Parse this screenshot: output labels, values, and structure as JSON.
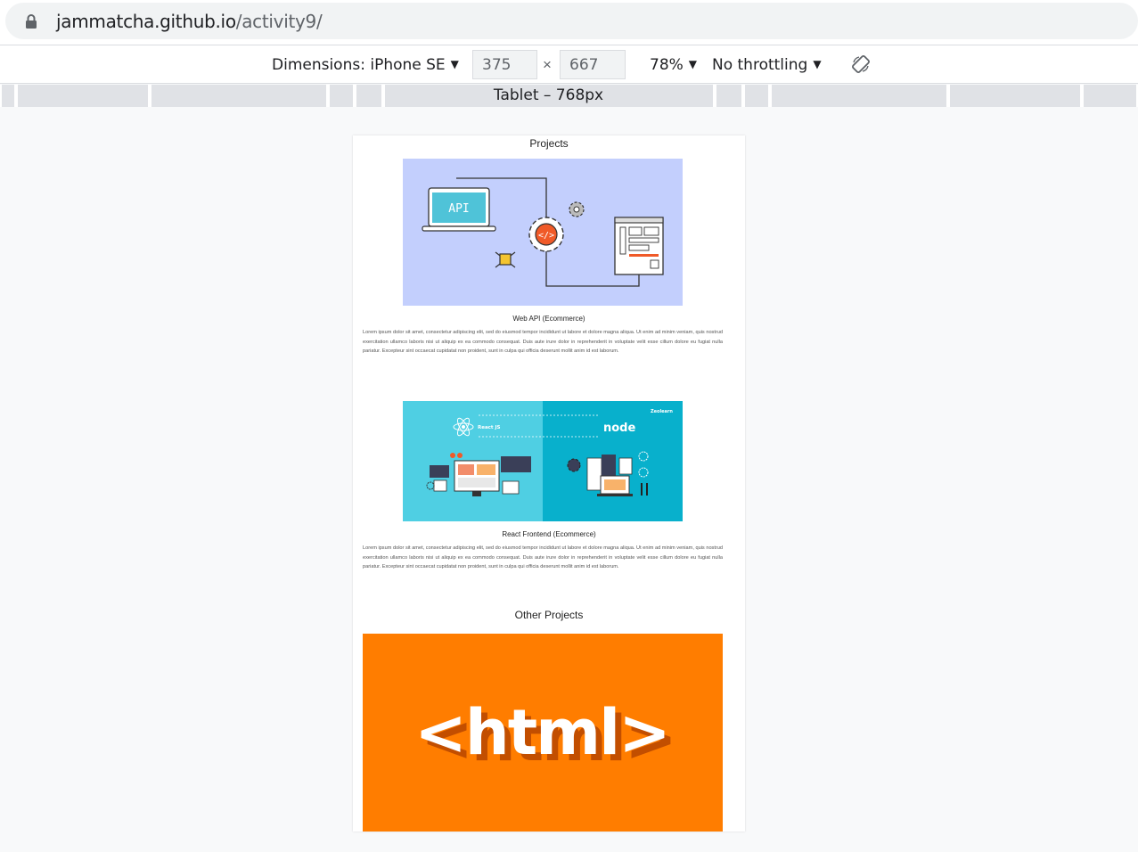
{
  "browser": {
    "url_host": "jammatcha.github.io",
    "url_path": "/activity9/"
  },
  "devtools": {
    "dimensions_label": "Dimensions: iPhone SE",
    "width": "375",
    "height": "667",
    "times": "×",
    "zoom": "78%",
    "throttling": "No throttling",
    "media_query_label": "Tablet – 768px"
  },
  "page": {
    "projects_heading": "Projects",
    "projects": [
      {
        "title": "Web API (Ecommerce)",
        "description": "Lorem ipsum dolor sit amet, consectetur adipiscing elit, sed do eiusmod tempor incididunt ut labore et dolore magna aliqua. Ut enim ad minim veniam, quis nostrud exercitation ullamco laboris nisi ut aliquip ex ea commodo consequat. Duis aute irure dolor in reprehenderit in voluptate velit esse cillum dolore eu fugiat nulla pariatur. Excepteur sint occaecat cupidatat non proident, sunt in culpa qui officia deserunt mollit anim id est laborum.",
        "image_text": "API"
      },
      {
        "title": "React Frontend (Ecommerce)",
        "description": "Lorem ipsum dolor sit amet, consectetur adipiscing elit, sed do eiusmod tempor incididunt ut labore et dolore magna aliqua. Ut enim ad minim veniam, quis nostrud exercitation ullamco laboris nisi ut aliquip ex ea commodo consequat. Duis aute irure dolor in reprehenderit in voluptate velit esse cillum dolore eu fugiat nulla pariatur. Excepteur sint occaecat cupidatat non proident, sunt in culpa qui officia deserunt mollit anim id est laborum.",
        "image_text_left": "React JS",
        "image_text_right": "node",
        "image_brand": "Zeolearn"
      }
    ],
    "other_heading": "Other Projects",
    "html_banner_text": "<html>"
  },
  "colors": {
    "api_bg": "#c3cffd",
    "react_left": "#4fcfe3",
    "react_right": "#08b0cc",
    "html_orange": "#ff7d00",
    "accent_red": "#f05a28"
  }
}
